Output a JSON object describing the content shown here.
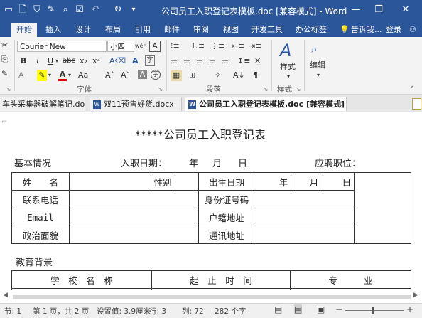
{
  "window": {
    "title": "公司员工入职登记表模板.doc [兼容模式] - Word",
    "quick_access": [
      "save-icon",
      "undo-icon",
      "redo-icon"
    ]
  },
  "ribbon_tabs": [
    "开始",
    "插入",
    "设计",
    "布局",
    "引用",
    "邮件",
    "审阅",
    "视图",
    "开发工具",
    "办公标签"
  ],
  "tell_me": "告诉我...",
  "login": "登录",
  "font": {
    "name": "Courier New",
    "size": "小四",
    "group_label": "字体",
    "bold": "B",
    "italic": "I",
    "underline": "U",
    "strike": "abc",
    "sub": "x₂",
    "sup": "x²",
    "grow": "A˄",
    "shrink": "A˅",
    "aa": "Aa",
    "wen": "wén"
  },
  "paragraph": {
    "group_label": "段落"
  },
  "styles": {
    "label": "样式",
    "group_label": "样式"
  },
  "editing": {
    "label": "编辑"
  },
  "doc_tabs": [
    "车头采集器破解笔记.docx",
    "双11预售好货.docx",
    "公司员工入职登记表模板.doc [兼容模式]"
  ],
  "document": {
    "title": "*****公司员工入职登记表",
    "basic_info": "基本情况",
    "entry_date": "入职日期：",
    "year": "年",
    "month": "月",
    "day": "日",
    "position": "应聘职位：",
    "table1": [
      [
        "姓　　名",
        "",
        "性别",
        "",
        "出生日期",
        "年",
        "月",
        "日"
      ],
      [
        "联系电话",
        "",
        "身份证号码",
        ""
      ],
      [
        "Email",
        "",
        "户籍地址",
        ""
      ],
      [
        "政治面貌",
        "",
        "通讯地址",
        ""
      ]
    ],
    "education": "教育背景",
    "table2_headers": [
      "学　校　名　称",
      "起　止　时　间",
      "专　　　业"
    ]
  },
  "status": {
    "section": "节: 1",
    "page": "第 1 页，共 2 页",
    "position": "设置值: 3.9厘米",
    "line": "行: 3",
    "column": "列: 72",
    "chars": "282 个字"
  }
}
